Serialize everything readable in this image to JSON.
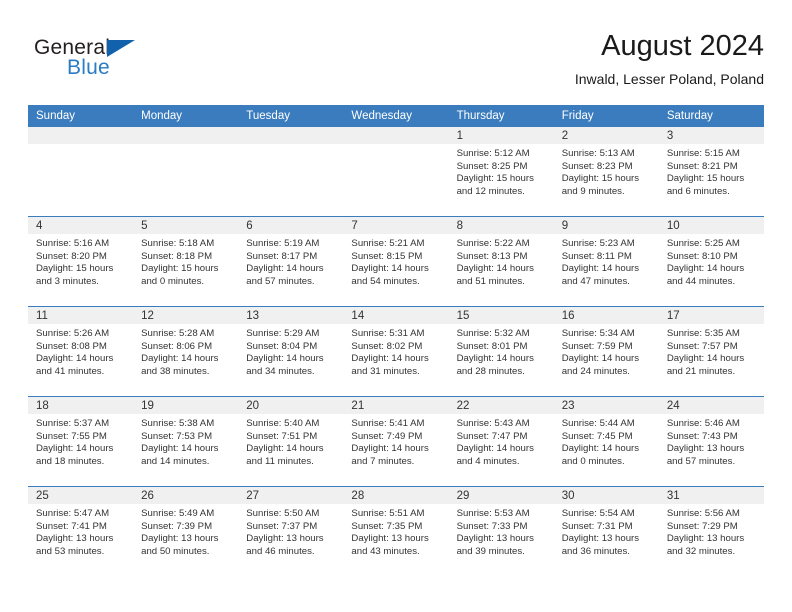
{
  "logo": {
    "word_top": "General",
    "word_bottom": "Blue",
    "triangle_color": "#1261ad",
    "blue_color": "#2b7cc4"
  },
  "header": {
    "title": "August 2024",
    "subtitle": "Inwald, Lesser Poland, Poland"
  },
  "theme": {
    "header_bg": "#3a7cbe",
    "daynum_bg": "#f0f0f0",
    "grid_line": "#3a7cbe"
  },
  "weekdays": [
    "Sunday",
    "Monday",
    "Tuesday",
    "Wednesday",
    "Thursday",
    "Friday",
    "Saturday"
  ],
  "labels": {
    "sunrise": "Sunrise:",
    "sunset": "Sunset:",
    "daylight": "Daylight:"
  },
  "weeks": [
    [
      {
        "day": "",
        "sunrise": "",
        "sunset": "",
        "daylight_line1": "",
        "daylight_line2": ""
      },
      {
        "day": "",
        "sunrise": "",
        "sunset": "",
        "daylight_line1": "",
        "daylight_line2": ""
      },
      {
        "day": "",
        "sunrise": "",
        "sunset": "",
        "daylight_line1": "",
        "daylight_line2": ""
      },
      {
        "day": "",
        "sunrise": "",
        "sunset": "",
        "daylight_line1": "",
        "daylight_line2": ""
      },
      {
        "day": "1",
        "sunrise": "Sunrise: 5:12 AM",
        "sunset": "Sunset: 8:25 PM",
        "daylight_line1": "Daylight: 15 hours",
        "daylight_line2": "and 12 minutes."
      },
      {
        "day": "2",
        "sunrise": "Sunrise: 5:13 AM",
        "sunset": "Sunset: 8:23 PM",
        "daylight_line1": "Daylight: 15 hours",
        "daylight_line2": "and 9 minutes."
      },
      {
        "day": "3",
        "sunrise": "Sunrise: 5:15 AM",
        "sunset": "Sunset: 8:21 PM",
        "daylight_line1": "Daylight: 15 hours",
        "daylight_line2": "and 6 minutes."
      }
    ],
    [
      {
        "day": "4",
        "sunrise": "Sunrise: 5:16 AM",
        "sunset": "Sunset: 8:20 PM",
        "daylight_line1": "Daylight: 15 hours",
        "daylight_line2": "and 3 minutes."
      },
      {
        "day": "5",
        "sunrise": "Sunrise: 5:18 AM",
        "sunset": "Sunset: 8:18 PM",
        "daylight_line1": "Daylight: 15 hours",
        "daylight_line2": "and 0 minutes."
      },
      {
        "day": "6",
        "sunrise": "Sunrise: 5:19 AM",
        "sunset": "Sunset: 8:17 PM",
        "daylight_line1": "Daylight: 14 hours",
        "daylight_line2": "and 57 minutes."
      },
      {
        "day": "7",
        "sunrise": "Sunrise: 5:21 AM",
        "sunset": "Sunset: 8:15 PM",
        "daylight_line1": "Daylight: 14 hours",
        "daylight_line2": "and 54 minutes."
      },
      {
        "day": "8",
        "sunrise": "Sunrise: 5:22 AM",
        "sunset": "Sunset: 8:13 PM",
        "daylight_line1": "Daylight: 14 hours",
        "daylight_line2": "and 51 minutes."
      },
      {
        "day": "9",
        "sunrise": "Sunrise: 5:23 AM",
        "sunset": "Sunset: 8:11 PM",
        "daylight_line1": "Daylight: 14 hours",
        "daylight_line2": "and 47 minutes."
      },
      {
        "day": "10",
        "sunrise": "Sunrise: 5:25 AM",
        "sunset": "Sunset: 8:10 PM",
        "daylight_line1": "Daylight: 14 hours",
        "daylight_line2": "and 44 minutes."
      }
    ],
    [
      {
        "day": "11",
        "sunrise": "Sunrise: 5:26 AM",
        "sunset": "Sunset: 8:08 PM",
        "daylight_line1": "Daylight: 14 hours",
        "daylight_line2": "and 41 minutes."
      },
      {
        "day": "12",
        "sunrise": "Sunrise: 5:28 AM",
        "sunset": "Sunset: 8:06 PM",
        "daylight_line1": "Daylight: 14 hours",
        "daylight_line2": "and 38 minutes."
      },
      {
        "day": "13",
        "sunrise": "Sunrise: 5:29 AM",
        "sunset": "Sunset: 8:04 PM",
        "daylight_line1": "Daylight: 14 hours",
        "daylight_line2": "and 34 minutes."
      },
      {
        "day": "14",
        "sunrise": "Sunrise: 5:31 AM",
        "sunset": "Sunset: 8:02 PM",
        "daylight_line1": "Daylight: 14 hours",
        "daylight_line2": "and 31 minutes."
      },
      {
        "day": "15",
        "sunrise": "Sunrise: 5:32 AM",
        "sunset": "Sunset: 8:01 PM",
        "daylight_line1": "Daylight: 14 hours",
        "daylight_line2": "and 28 minutes."
      },
      {
        "day": "16",
        "sunrise": "Sunrise: 5:34 AM",
        "sunset": "Sunset: 7:59 PM",
        "daylight_line1": "Daylight: 14 hours",
        "daylight_line2": "and 24 minutes."
      },
      {
        "day": "17",
        "sunrise": "Sunrise: 5:35 AM",
        "sunset": "Sunset: 7:57 PM",
        "daylight_line1": "Daylight: 14 hours",
        "daylight_line2": "and 21 minutes."
      }
    ],
    [
      {
        "day": "18",
        "sunrise": "Sunrise: 5:37 AM",
        "sunset": "Sunset: 7:55 PM",
        "daylight_line1": "Daylight: 14 hours",
        "daylight_line2": "and 18 minutes."
      },
      {
        "day": "19",
        "sunrise": "Sunrise: 5:38 AM",
        "sunset": "Sunset: 7:53 PM",
        "daylight_line1": "Daylight: 14 hours",
        "daylight_line2": "and 14 minutes."
      },
      {
        "day": "20",
        "sunrise": "Sunrise: 5:40 AM",
        "sunset": "Sunset: 7:51 PM",
        "daylight_line1": "Daylight: 14 hours",
        "daylight_line2": "and 11 minutes."
      },
      {
        "day": "21",
        "sunrise": "Sunrise: 5:41 AM",
        "sunset": "Sunset: 7:49 PM",
        "daylight_line1": "Daylight: 14 hours",
        "daylight_line2": "and 7 minutes."
      },
      {
        "day": "22",
        "sunrise": "Sunrise: 5:43 AM",
        "sunset": "Sunset: 7:47 PM",
        "daylight_line1": "Daylight: 14 hours",
        "daylight_line2": "and 4 minutes."
      },
      {
        "day": "23",
        "sunrise": "Sunrise: 5:44 AM",
        "sunset": "Sunset: 7:45 PM",
        "daylight_line1": "Daylight: 14 hours",
        "daylight_line2": "and 0 minutes."
      },
      {
        "day": "24",
        "sunrise": "Sunrise: 5:46 AM",
        "sunset": "Sunset: 7:43 PM",
        "daylight_line1": "Daylight: 13 hours",
        "daylight_line2": "and 57 minutes."
      }
    ],
    [
      {
        "day": "25",
        "sunrise": "Sunrise: 5:47 AM",
        "sunset": "Sunset: 7:41 PM",
        "daylight_line1": "Daylight: 13 hours",
        "daylight_line2": "and 53 minutes."
      },
      {
        "day": "26",
        "sunrise": "Sunrise: 5:49 AM",
        "sunset": "Sunset: 7:39 PM",
        "daylight_line1": "Daylight: 13 hours",
        "daylight_line2": "and 50 minutes."
      },
      {
        "day": "27",
        "sunrise": "Sunrise: 5:50 AM",
        "sunset": "Sunset: 7:37 PM",
        "daylight_line1": "Daylight: 13 hours",
        "daylight_line2": "and 46 minutes."
      },
      {
        "day": "28",
        "sunrise": "Sunrise: 5:51 AM",
        "sunset": "Sunset: 7:35 PM",
        "daylight_line1": "Daylight: 13 hours",
        "daylight_line2": "and 43 minutes."
      },
      {
        "day": "29",
        "sunrise": "Sunrise: 5:53 AM",
        "sunset": "Sunset: 7:33 PM",
        "daylight_line1": "Daylight: 13 hours",
        "daylight_line2": "and 39 minutes."
      },
      {
        "day": "30",
        "sunrise": "Sunrise: 5:54 AM",
        "sunset": "Sunset: 7:31 PM",
        "daylight_line1": "Daylight: 13 hours",
        "daylight_line2": "and 36 minutes."
      },
      {
        "day": "31",
        "sunrise": "Sunrise: 5:56 AM",
        "sunset": "Sunset: 7:29 PM",
        "daylight_line1": "Daylight: 13 hours",
        "daylight_line2": "and 32 minutes."
      }
    ]
  ]
}
